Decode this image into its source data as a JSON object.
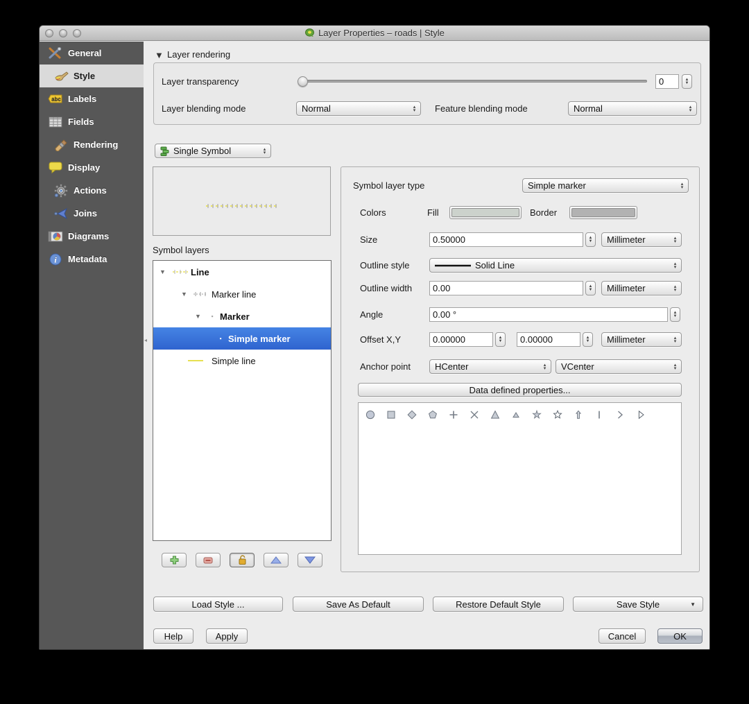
{
  "window": {
    "title": "Layer Properties – roads | Style"
  },
  "sidebar": {
    "items": [
      {
        "label": "General",
        "icon": "tools-icon"
      },
      {
        "label": "Style",
        "icon": "paintbrush-icon"
      },
      {
        "label": "Labels",
        "icon": "abc-tag-icon"
      },
      {
        "label": "Fields",
        "icon": "table-icon"
      },
      {
        "label": "Rendering",
        "icon": "brush-icon"
      },
      {
        "label": "Display",
        "icon": "speech-bubble-icon"
      },
      {
        "label": "Actions",
        "icon": "gear-icon"
      },
      {
        "label": "Joins",
        "icon": "join-arrow-icon"
      },
      {
        "label": "Diagrams",
        "icon": "diagram-icon"
      },
      {
        "label": "Metadata",
        "icon": "info-icon"
      }
    ]
  },
  "rendering": {
    "header": "Layer rendering",
    "transparency_label": "Layer transparency",
    "transparency_value": "0",
    "layer_blend_label": "Layer blending mode",
    "layer_blend_value": "Normal",
    "feature_blend_label": "Feature blending mode",
    "feature_blend_value": "Normal"
  },
  "symbol": {
    "renderer_value": "Single Symbol",
    "symbol_layers_label": "Symbol layers",
    "tree": {
      "line": "Line",
      "marker_line": "Marker line",
      "marker": "Marker",
      "simple_marker": "Simple marker",
      "simple_line": "Simple line"
    }
  },
  "properties": {
    "symbol_layer_type_label": "Symbol layer type",
    "symbol_layer_type_value": "Simple marker",
    "colors_label": "Colors",
    "fill_label": "Fill",
    "border_label": "Border",
    "size_label": "Size",
    "size_value": "0.50000",
    "unit_millimeter": "Millimeter",
    "outline_style_label": "Outline style",
    "outline_style_value": "Solid Line",
    "outline_width_label": "Outline width",
    "outline_width_value": "0.00",
    "angle_label": "Angle",
    "angle_value": "0.00 °",
    "offset_label": "Offset X,Y",
    "offset_x_value": "0.00000",
    "offset_y_value": "0.00000",
    "anchor_label": "Anchor point",
    "anchor_h_value": "HCenter",
    "anchor_v_value": "VCenter",
    "ddp_button": "Data defined properties...",
    "shapes": [
      "circle",
      "square",
      "diamond",
      "pentagon",
      "plus",
      "cross",
      "triangle",
      "small-triangle",
      "star-thin",
      "star",
      "arrow-up",
      "vertical-line",
      "chevron-right",
      "triangle-right"
    ]
  },
  "style_buttons": {
    "load": "Load Style ...",
    "save_default": "Save As Default",
    "restore": "Restore Default Style",
    "save_style": "Save Style"
  },
  "dialog_buttons": {
    "help": "Help",
    "apply": "Apply",
    "cancel": "Cancel",
    "ok": "OK"
  },
  "colors": {
    "selection_blue": "#3b74d8",
    "fill_swatch": "#ccd2cc",
    "border_swatch": "#b2b2b2",
    "symbol_yellow": "#e8e45c",
    "sidebar_gray": "#575757"
  }
}
